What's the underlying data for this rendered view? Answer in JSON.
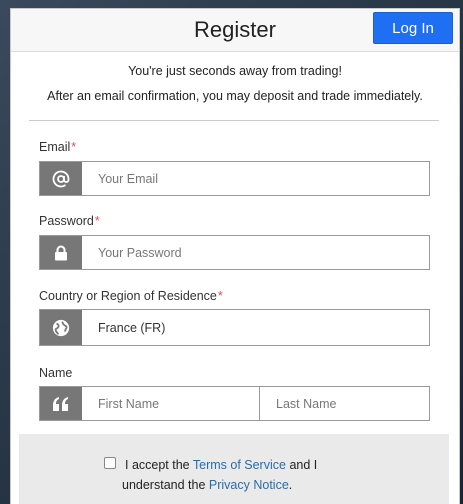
{
  "header": {
    "title": "Register",
    "login_label": "Log In"
  },
  "intro": {
    "line1": "You're just seconds away from trading!",
    "line2": "After an email confirmation, you may deposit and trade immediately."
  },
  "email": {
    "label": "Email",
    "required": "*",
    "placeholder": "Your Email",
    "icon": "at-icon"
  },
  "password": {
    "label": "Password",
    "required": "*",
    "placeholder": "Your Password",
    "icon": "lock-icon"
  },
  "country": {
    "label": "Country or Region of Residence",
    "required": "*",
    "value": "France (FR)",
    "icon": "globe-icon"
  },
  "name": {
    "label": "Name",
    "first_placeholder": "First Name",
    "last_placeholder": "Last Name",
    "icon": "quote-icon"
  },
  "terms": {
    "prefix": "I accept the",
    "tos_link": "Terms of Service",
    "middle": "and I",
    "line2_prefix": "understand the",
    "privacy_link": "Privacy Notice",
    "suffix": "."
  },
  "colors": {
    "accent": "#1e6ff1",
    "icon_bg": "#777777",
    "link": "#2a6ca8",
    "required": "#d9534f"
  }
}
